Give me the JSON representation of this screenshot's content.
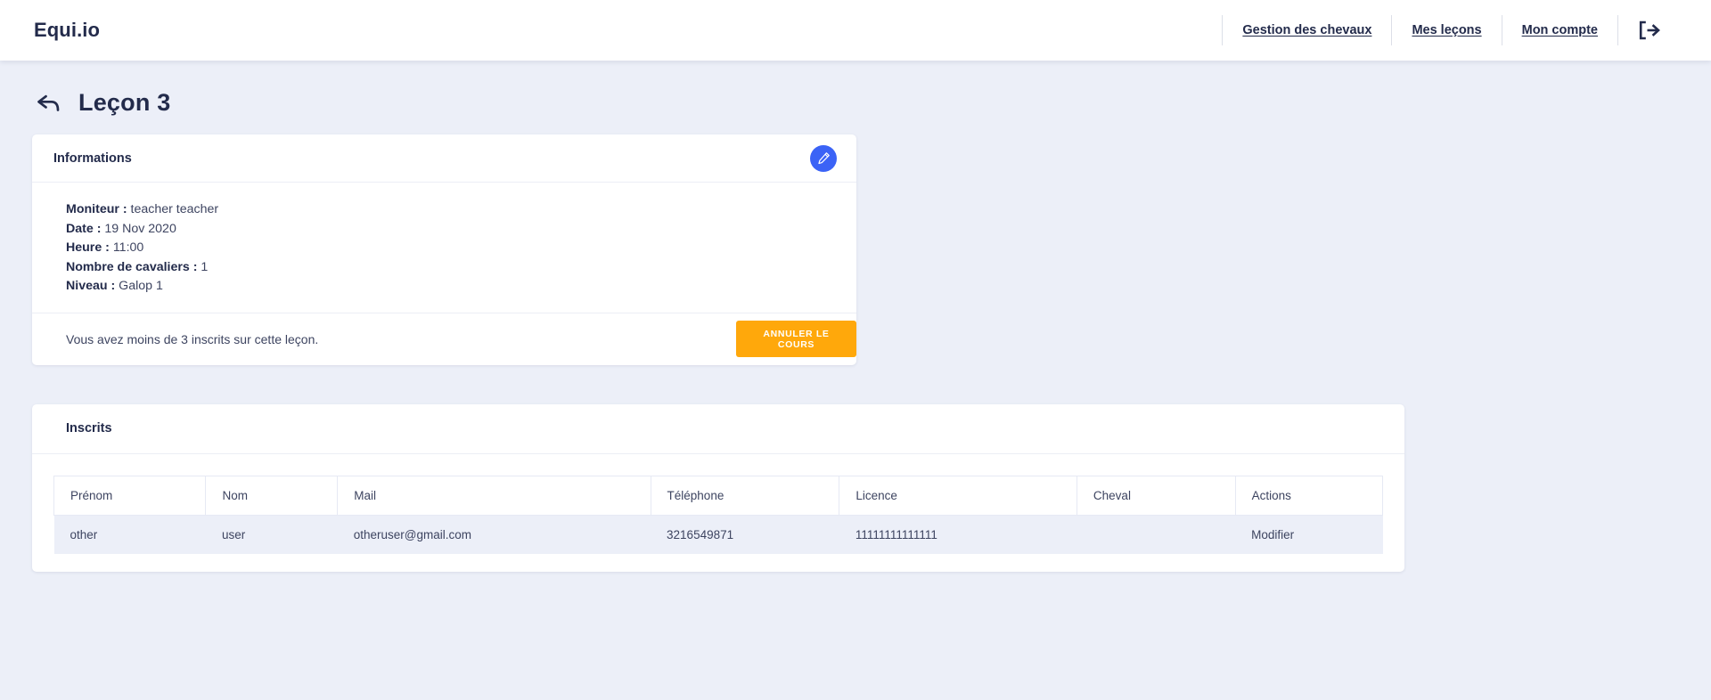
{
  "header": {
    "brand": "Equi.io",
    "nav": [
      {
        "label": "Gestion des chevaux"
      },
      {
        "label": "Mes leçons"
      },
      {
        "label": "Mon compte"
      }
    ],
    "logout_icon": "logout-icon"
  },
  "page": {
    "back_icon": "back-arrow-icon",
    "title": "Leçon 3"
  },
  "info_card": {
    "title": "Informations",
    "edit_icon": "pencil-icon",
    "rows": [
      {
        "label": "Moniteur :",
        "value": "teacher teacher"
      },
      {
        "label": "Date :",
        "value": "19 Nov 2020"
      },
      {
        "label": "Heure :",
        "value": "11:00"
      },
      {
        "label": "Nombre de cavaliers :",
        "value": "1"
      },
      {
        "label": "Niveau :",
        "value": "Galop 1"
      }
    ],
    "footer_note": "Vous avez moins de 3 inscrits sur cette leçon.",
    "cancel_button": "Annuler le cours"
  },
  "inscrits_card": {
    "title": "Inscrits",
    "columns": [
      "Prénom",
      "Nom",
      "Mail",
      "Téléphone",
      "Licence",
      "Cheval",
      "Actions"
    ],
    "rows": [
      {
        "prenom": "other",
        "nom": "user",
        "mail": "otheruser@gmail.com",
        "telephone": "3216549871",
        "licence": "11111111111111",
        "cheval": "",
        "action": "Modifier"
      }
    ]
  },
  "colors": {
    "background": "#eceff8",
    "card": "#ffffff",
    "text": "#232b4b",
    "accent_blue": "#3b63f6",
    "accent_orange": "#ffa80b",
    "row_background": "#eceff8"
  }
}
